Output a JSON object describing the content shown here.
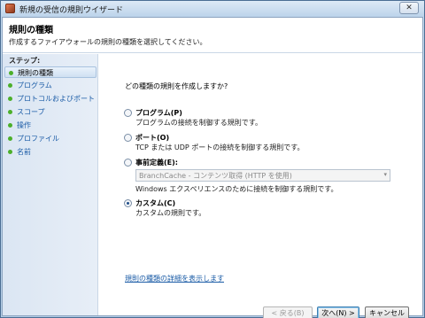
{
  "window": {
    "title": "新規の受信の規則ウイザード",
    "close_label": "✕"
  },
  "header": {
    "title": "規則の種類",
    "description": "作成するファイアウォールの規則の種類を選択してください。"
  },
  "sidebar": {
    "steps_label": "ステップ:",
    "items": [
      {
        "label": "規則の種類",
        "active": true
      },
      {
        "label": "プログラム"
      },
      {
        "label": "プロトコルおよびポート"
      },
      {
        "label": "スコープ"
      },
      {
        "label": "操作"
      },
      {
        "label": "プロファイル"
      },
      {
        "label": "名前"
      }
    ]
  },
  "main": {
    "question": "どの種類の規則を作成しますか?",
    "options": [
      {
        "title": "プログラム(P)",
        "desc": "プログラムの接続を制御する規則です。",
        "checked": false
      },
      {
        "title": "ポート(O)",
        "desc": "TCP または UDP ポートの接続を制御する規則です。",
        "checked": false
      },
      {
        "title": "事前定義(E):",
        "desc": "Windows エクスペリエンスのために接続を制御する規則です。",
        "checked": false
      },
      {
        "title": "カスタム(C)",
        "desc": "カスタムの規則です。",
        "checked": true
      }
    ],
    "predefined_select": {
      "value": "BranchCache - コンテンツ取得 (HTTP を使用)",
      "arrow": "▾"
    },
    "details_link": "規則の種類の詳細を表示します"
  },
  "footer": {
    "back_label": "< 戻る(B)",
    "next_label": "次へ(N) >",
    "cancel_label": "キャンセル"
  }
}
